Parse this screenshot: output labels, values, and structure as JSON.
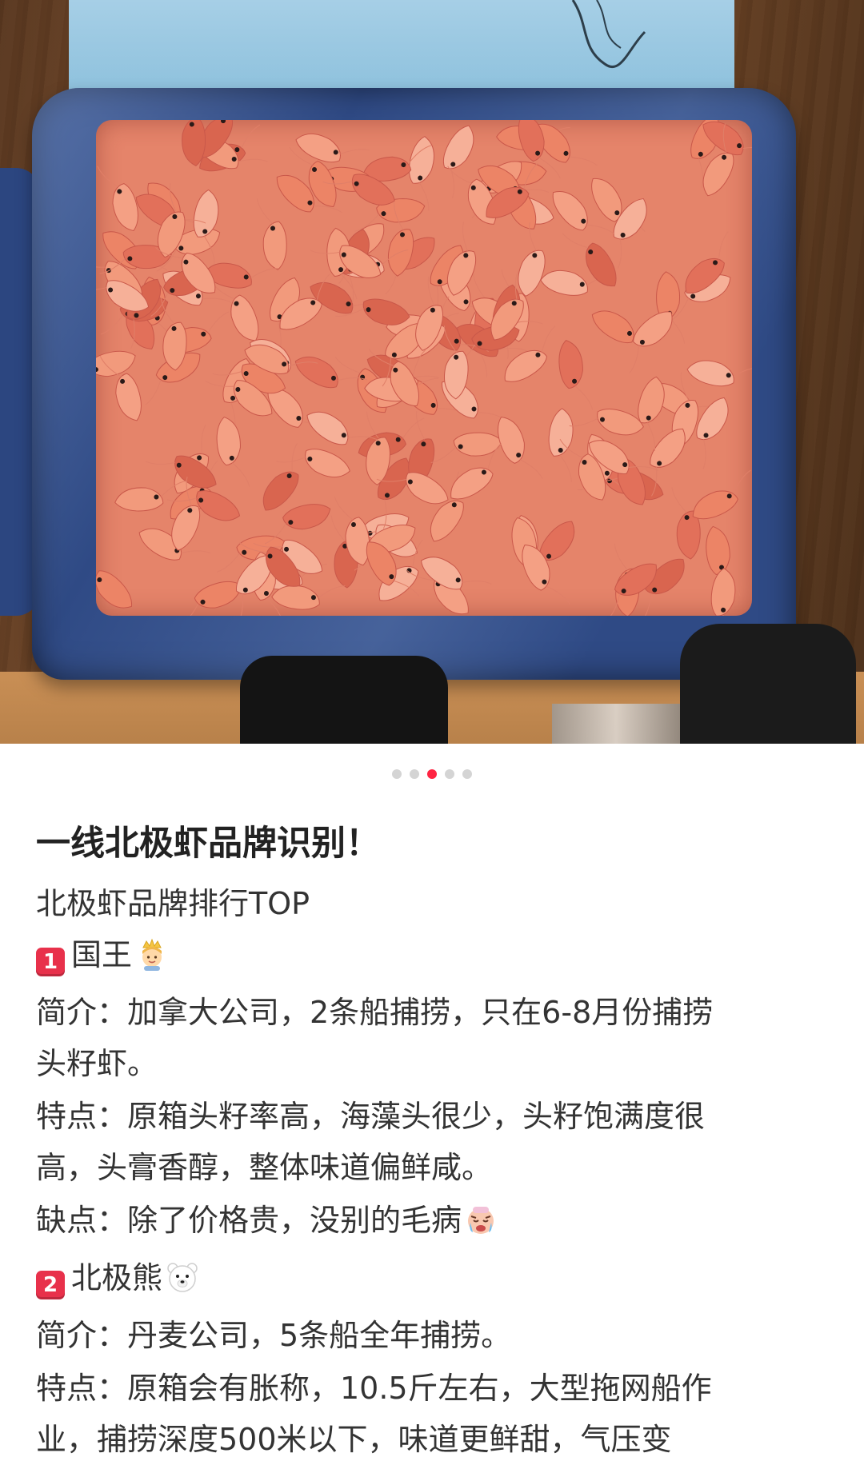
{
  "photo": {
    "description_icon": "shrimp-box-photo",
    "carousel": {
      "count": 5,
      "active_index": 2
    }
  },
  "colors": {
    "accent": "#ff2442",
    "badge": "#e8314b",
    "dot_inactive": "#d4d4d4"
  },
  "post": {
    "title": "一线北极虾品牌识别！",
    "intro": "北极虾品牌排行TOP",
    "brands": [
      {
        "number": "1",
        "name": "国王",
        "icon": "prince-emoji-icon",
        "profile_line1": "简介：加拿大公司，2条船捕捞，只在6-8月份捕捞",
        "profile_line2": "头籽虾。",
        "feature_line1": "特点：原箱头籽率高，海藻头很少，头籽饱满度很",
        "feature_line2": "高，头膏香醇，整体味道偏鲜咸。",
        "drawback": "缺点：除了价格贵，没别的毛病",
        "drawback_icon": "crying-face-emoji-icon"
      },
      {
        "number": "2",
        "name": "北极熊",
        "icon": "polar-bear-emoji-icon",
        "profile_line1": "简介：丹麦公司，5条船全年捕捞。",
        "feature_line1": "特点：原箱会有胀称，10.5斤左右，大型拖网船作",
        "feature_line2": "业，捕捞深度500米以下，味道更鲜甜，气压变"
      }
    ]
  }
}
